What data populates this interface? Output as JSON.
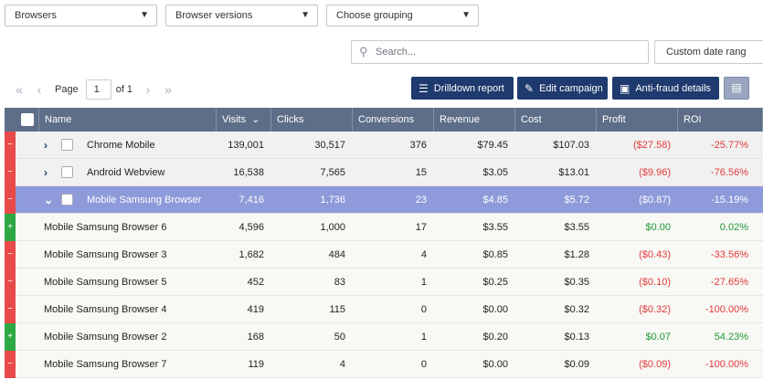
{
  "filters": {
    "browsers": "Browsers",
    "browser_versions": "Browser versions",
    "grouping": "Choose grouping"
  },
  "search": {
    "placeholder": "Search..."
  },
  "date_range": "Custom date rang",
  "pager": {
    "page_label": "Page",
    "page": "1",
    "of_label": "of 1"
  },
  "buttons": {
    "drilldown": "Drilldown report",
    "edit": "Edit campaign",
    "antifraud": "Anti-fraud details"
  },
  "columns": [
    "Name",
    "Visits",
    "Clicks",
    "Conversions",
    "Revenue",
    "Cost",
    "Profit",
    "ROI"
  ],
  "sort_indicator": "⌄",
  "rows": [
    {
      "name": "Chrome Mobile",
      "visits": "139,001",
      "clicks": "30,517",
      "conversions": "376",
      "revenue": "$79.45",
      "cost": "$107.03",
      "profit": "($27.58)",
      "roi": "-25.77%",
      "status": "red",
      "level": 1,
      "selected": false,
      "profit_sign": "neg"
    },
    {
      "name": "Android Webview",
      "visits": "16,538",
      "clicks": "7,565",
      "conversions": "15",
      "revenue": "$3.05",
      "cost": "$13.01",
      "profit": "($9.96)",
      "roi": "-76.56%",
      "status": "red",
      "level": 1,
      "selected": false,
      "profit_sign": "neg"
    },
    {
      "name": "Mobile Samsung Browser",
      "visits": "7,416",
      "clicks": "1,736",
      "conversions": "23",
      "revenue": "$4.85",
      "cost": "$5.72",
      "profit": "($0.87)",
      "roi": "-15.19%",
      "status": "red",
      "level": 1,
      "selected": true,
      "profit_sign": "neg"
    },
    {
      "name": "Mobile Samsung Browser 6",
      "visits": "4,596",
      "clicks": "1,000",
      "conversions": "17",
      "revenue": "$3.55",
      "cost": "$3.55",
      "profit": "$0.00",
      "roi": "0.02%",
      "status": "green",
      "level": 2,
      "selected": false,
      "profit_sign": "pos"
    },
    {
      "name": "Mobile Samsung Browser 3",
      "visits": "1,682",
      "clicks": "484",
      "conversions": "4",
      "revenue": "$0.85",
      "cost": "$1.28",
      "profit": "($0.43)",
      "roi": "-33.56%",
      "status": "red",
      "level": 2,
      "selected": false,
      "profit_sign": "neg"
    },
    {
      "name": "Mobile Samsung Browser 5",
      "visits": "452",
      "clicks": "83",
      "conversions": "1",
      "revenue": "$0.25",
      "cost": "$0.35",
      "profit": "($0.10)",
      "roi": "-27.65%",
      "status": "red",
      "level": 2,
      "selected": false,
      "profit_sign": "neg"
    },
    {
      "name": "Mobile Samsung Browser 4",
      "visits": "419",
      "clicks": "115",
      "conversions": "0",
      "revenue": "$0.00",
      "cost": "$0.32",
      "profit": "($0.32)",
      "roi": "-100.00%",
      "status": "red",
      "level": 2,
      "selected": false,
      "profit_sign": "neg"
    },
    {
      "name": "Mobile Samsung Browser 2",
      "visits": "168",
      "clicks": "50",
      "conversions": "1",
      "revenue": "$0.20",
      "cost": "$0.13",
      "profit": "$0.07",
      "roi": "54.23%",
      "status": "green",
      "level": 2,
      "selected": false,
      "profit_sign": "pos"
    },
    {
      "name": "Mobile Samsung Browser 7",
      "visits": "119",
      "clicks": "4",
      "conversions": "0",
      "revenue": "$0.00",
      "cost": "$0.09",
      "profit": "($0.09)",
      "roi": "-100.00%",
      "status": "red",
      "level": 2,
      "selected": false,
      "profit_sign": "neg"
    }
  ],
  "colors": {
    "header": "#5e6e88",
    "button": "#1e3a6e",
    "selected_row": "#8e9ad9",
    "negative": "#e23a3a",
    "positive": "#1f9a35"
  }
}
